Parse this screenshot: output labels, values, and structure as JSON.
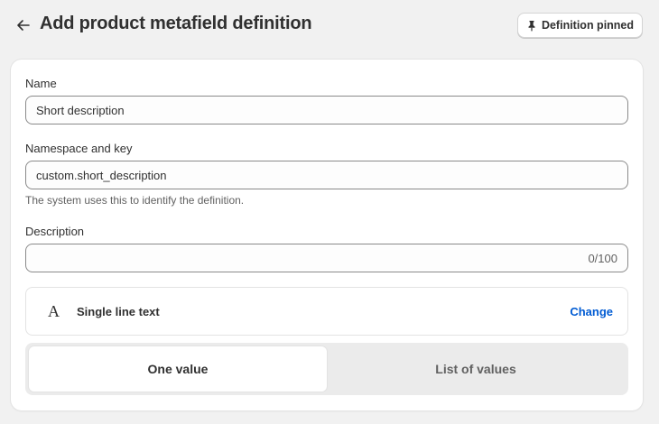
{
  "header": {
    "title": "Add product metafield definition",
    "back_icon": "arrow-left-icon",
    "pin_button": {
      "label": "Definition pinned",
      "icon": "pin-icon"
    }
  },
  "form": {
    "name": {
      "label": "Name",
      "value": "Short description"
    },
    "namespace": {
      "label": "Namespace and key",
      "value": "custom.short_description",
      "help": "The system uses this to identify the definition."
    },
    "description": {
      "label": "Description",
      "value": "",
      "counter": "0/100"
    },
    "type": {
      "glyph": "A",
      "icon": "text-type-icon",
      "label": "Single line text",
      "change_label": "Change"
    },
    "value_mode": {
      "options": [
        "One value",
        "List of values"
      ],
      "selected": "One value"
    }
  },
  "colors": {
    "link": "#005bd3",
    "background": "#f1f1f1",
    "text": "#303030"
  }
}
